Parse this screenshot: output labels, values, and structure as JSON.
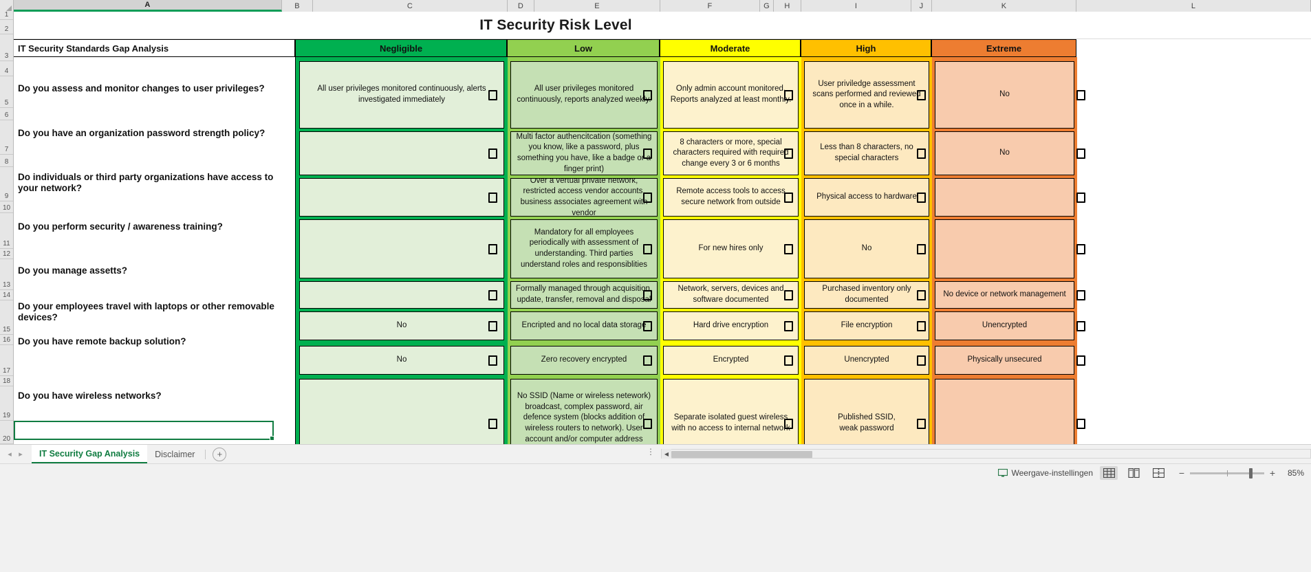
{
  "title": "IT Security Risk Level",
  "columns": {
    "letters": [
      "A",
      "B",
      "C",
      "D",
      "E",
      "F",
      "G",
      "H",
      "I",
      "J",
      "K",
      "L"
    ],
    "active_letter": "A"
  },
  "row_numbers": [
    "1",
    "2",
    "3",
    "4",
    "5",
    "6",
    "7",
    "8",
    "9",
    "10",
    "11",
    "12",
    "13",
    "14",
    "15",
    "16",
    "17",
    "18",
    "19",
    "20"
  ],
  "header": {
    "question_col": "IT Security Standards Gap Analysis",
    "levels": [
      {
        "label": "Negligible",
        "color": "#00b050",
        "cell_color": "#e2efd9"
      },
      {
        "label": "Low",
        "color": "#92d050",
        "cell_color": "#c5e0b4"
      },
      {
        "label": "Moderate",
        "color": "#ffff00",
        "cell_color": "#fdf2cd"
      },
      {
        "label": "High",
        "color": "#ffc000",
        "cell_color": "#fde9c0"
      },
      {
        "label": "Extreme",
        "color": "#ed7d31",
        "cell_color": "#f8cbad"
      }
    ]
  },
  "rows": [
    {
      "question": "Do you assess and monitor changes to user privileges?",
      "negligible": "All user privileges monitored continuously, alerts investigated immediately",
      "low": "All user privileges monitored continuously, reports analyzed weekly.",
      "moderate": "Only admin account monitored. Reports analyzed at least monthly.",
      "high": "User priviledge assessment scans performed and reviewed once in a while.",
      "extreme": "No"
    },
    {
      "question": "Do you have an organization password strength policy?",
      "negligible": "",
      "low": "Multi factor authencitcation (something you know, like a password, plus something you have, like a badge or a finger print)",
      "moderate": "8 characters or more, special characters required with required change every 3 or 6 months",
      "high": "Less than 8 characters, no special characters",
      "extreme": "No"
    },
    {
      "question": "Do individuals or third party organizations have access to your network?",
      "negligible": "",
      "low": "Over a vertual private network, restricted access vendor accounts, business associates agreement with vendor",
      "moderate": "Remote access tools to access secure network from outside",
      "high": "Physical access to hardware",
      "extreme": ""
    },
    {
      "question": "Do you perform security / awareness training?",
      "negligible": "",
      "low": "Mandatory for all employees periodically with assessment of understanding. Third parties understand roles and responsiblities",
      "moderate": "For new hires only",
      "high": "No",
      "extreme": ""
    },
    {
      "question": "Do you manage assetts?",
      "negligible": "",
      "low": "Formally managed through acquisition, update, transfer, removal and disposal",
      "moderate": "Network, servers, devices and software documented",
      "high": "Purchased inventory only documented",
      "extreme": "No device or network management"
    },
    {
      "question": "Do your employees travel with laptops or other removable devices?",
      "negligible": "No",
      "low": "Encripted and no local data storage",
      "moderate": "Hard drive encryption",
      "high": "File encryption",
      "extreme": "Unencrypted"
    },
    {
      "question": "Do you have remote backup solution?",
      "negligible": "No",
      "low": "Zero recovery encrypted",
      "moderate": "Encrypted",
      "high": "Unencrypted",
      "extreme": "Physically unsecured"
    },
    {
      "question": "Do you have wireless networks?",
      "negligible": "",
      "low": "No SSID (Name or wireless netework) broadcast, complex password, air defence system (blocks addition of wireless routers to network). User account and/or computer address access control. No public access.",
      "moderate": "Separate isolated guest wireless with no access to internal network",
      "high": "Published SSID,\nweak password",
      "extreme": ""
    }
  ],
  "sheet_tabs": {
    "prev_icon": "◂",
    "next_icon": "▸",
    "tabs": [
      {
        "label": "IT Security Gap Analysis",
        "active": true
      },
      {
        "label": "Disclaimer",
        "active": false
      }
    ],
    "add_sheet_icon": "+"
  },
  "status_bar": {
    "display_settings_label": "Weergave-instellingen",
    "display_settings_icon": "monitor-icon",
    "view_normal_icon": "grid-view-icon",
    "view_pagelayout_icon": "page-layout-icon",
    "view_pagebreak_icon": "page-break-icon",
    "zoom_out_icon": "−",
    "zoom_in_icon": "+",
    "zoom_level": "85%"
  }
}
